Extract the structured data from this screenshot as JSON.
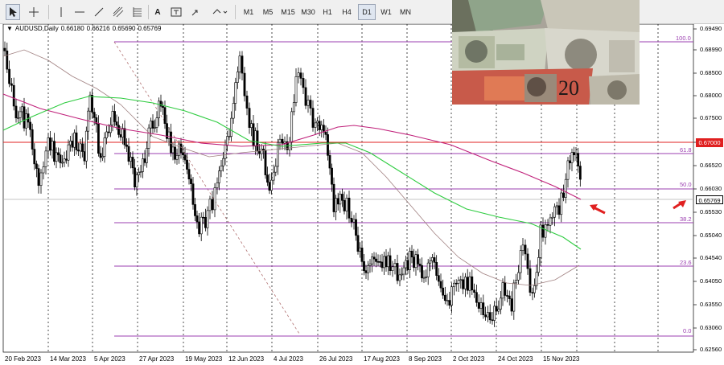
{
  "toolbar": {
    "timeframes": [
      "M1",
      "M5",
      "M15",
      "M30",
      "H1",
      "H4",
      "D1",
      "W1",
      "MN"
    ],
    "active_timeframe": "D1",
    "text_tool_label": "A"
  },
  "symbol": {
    "name": "AUDUSD,Daily",
    "open": "0.66180",
    "high": "0.66216",
    "low": "0.65690",
    "close": "0.65769"
  },
  "price_axis": [
    "0.69490",
    "0.68990",
    "0.68500",
    "0.68000",
    "0.67500",
    "0.67000",
    "0.66520",
    "0.66030",
    "0.65530",
    "0.65040",
    "0.64540",
    "0.64050",
    "0.63550",
    "0.63060",
    "0.62560"
  ],
  "current_price": "0.65769",
  "level_price": "0.67000",
  "fibonacci": [
    {
      "level": "100.0"
    },
    {
      "level": "61.8"
    },
    {
      "level": "50.0"
    },
    {
      "level": "38.2"
    },
    {
      "level": "23.6"
    },
    {
      "level": "0.0"
    }
  ],
  "date_axis": [
    "20 Feb 2023",
    "14 Mar 2023",
    "5 Apr 2023",
    "27 Apr 2023",
    "19 May 2023",
    "12 Jun 2023",
    "4 Jul 2023",
    "26 Jul 2023",
    "17 Aug 2023",
    "8 Sep 2023",
    "2 Oct 2023",
    "24 Oct 2023",
    "15 Nov 2023"
  ],
  "banknote": {
    "value": "20"
  },
  "colors": {
    "bull_candle": "#ffffff",
    "bear_candle": "#000000",
    "ma_green": "#2ecc40",
    "ma_magenta": "#c0207a",
    "ma_thin": "#9b7575",
    "fib": "#9b3fb0",
    "level_red": "#e02020",
    "arrow": "#e02020"
  }
}
